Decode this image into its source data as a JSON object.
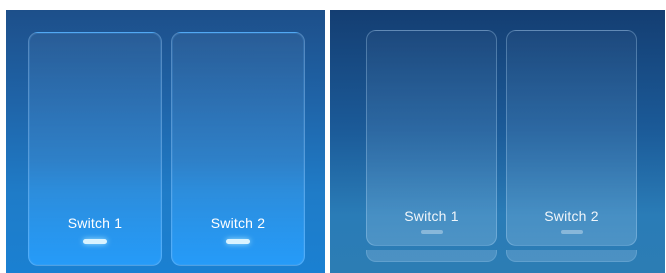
{
  "panels": [
    {
      "state": "on",
      "switches": [
        {
          "label": "Switch 1",
          "on": true
        },
        {
          "label": "Switch 2",
          "on": true
        }
      ]
    },
    {
      "state": "off",
      "switches": [
        {
          "label": "Switch 1",
          "on": false
        },
        {
          "label": "Switch 2",
          "on": false
        }
      ]
    }
  ],
  "colors": {
    "accent_on": "#d9f3ff",
    "background_on": "#1a80d2",
    "background_off": "#2c7db4"
  }
}
